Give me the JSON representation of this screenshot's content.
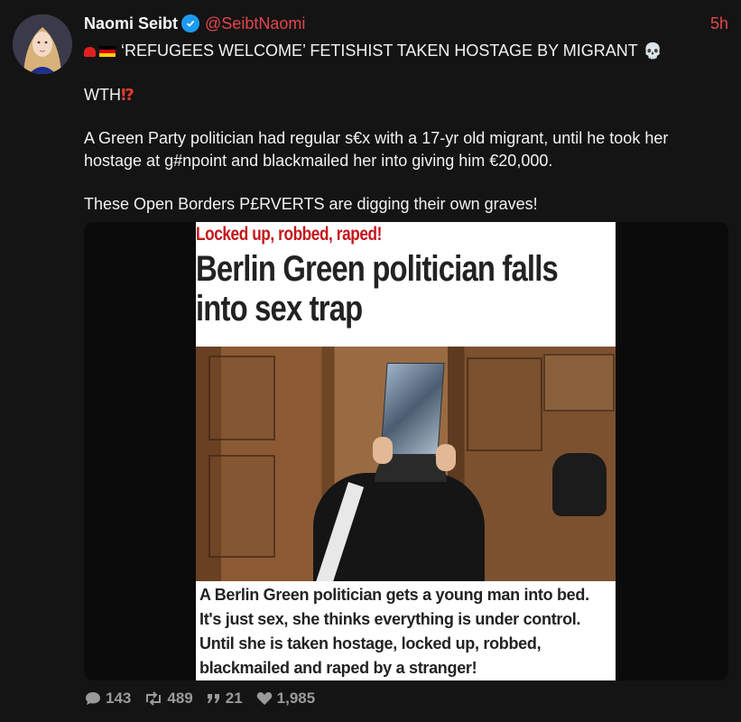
{
  "user": {
    "name": "Naomi Seibt",
    "handle": "@SeibtNaomi",
    "time": "5h"
  },
  "tweet": {
    "line1": "‘REFUGEES WELCOME’ FETISHIST TAKEN HOSTAGE BY MIGRANT",
    "wth": "WTH",
    "interrobang": "⁉",
    "paragraph": "A Green Party politician had regular s€x with a 17-yr old migrant, until he took her hostage at g#npoint and blackmailed her into giving him €20,000.",
    "closing": "These Open Borders P£RVERTS are digging their own graves!"
  },
  "article": {
    "kicker": "Locked up, robbed, raped!",
    "headline": "Berlin Green politician falls into sex trap",
    "caption": "A Berlin Green politician gets a young man into bed. It's just sex, she thinks everything is under control. Until she is taken hostage, locked up, robbed, blackmailed and raped by a stranger!"
  },
  "stats": {
    "replies": "143",
    "retweets": "489",
    "quotes": "21",
    "likes": "1,985"
  },
  "icons": {
    "verified": "verified-badge-icon",
    "siren": "police-light-icon",
    "flag": "germany-flag-icon",
    "skull": "skull-icon",
    "reply": "speech-bubble-icon",
    "retweet": "retweet-icon",
    "quote": "quote-icon",
    "like": "heart-icon"
  },
  "colors": {
    "background": "#141414",
    "accent": "#e4454b",
    "verified": "#1d9bf0",
    "kicker": "#c4161c"
  }
}
